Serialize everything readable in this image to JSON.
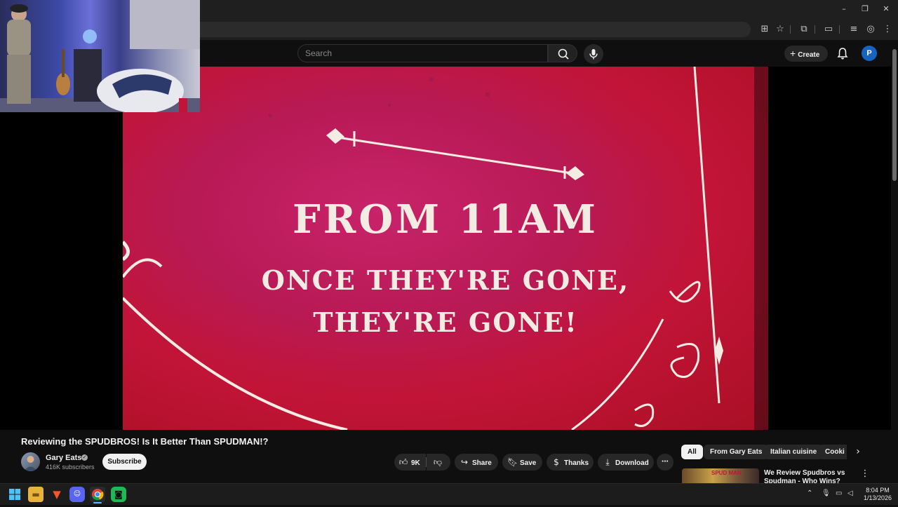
{
  "browser": {
    "window_controls": {
      "minimize": "–",
      "restore": "❐",
      "close": "✕"
    }
  },
  "masthead": {
    "search_placeholder": "Search",
    "create_label": "Create",
    "avatar_letter": "P"
  },
  "video": {
    "sign_line1": "FROM 11AM",
    "sign_line2": "ONCE THEY'RE GONE,",
    "sign_line3": "THEY'RE GONE!"
  },
  "watch": {
    "title": "Reviewing the SPUDBROS! Is It Better Than SPUDMAN!?",
    "channel_name": "Gary Eats",
    "subscribers": "416K subscribers",
    "subscribe_label": "Subscribe",
    "likes": "9K",
    "share_label": "Share",
    "save_label": "Save",
    "thanks_label": "Thanks",
    "download_label": "Download"
  },
  "chips": [
    "All",
    "From Gary Eats",
    "Italian cuisine",
    "Cooki"
  ],
  "recommendation": {
    "title": "We Review Spudbros vs Spudman - Who Wins?",
    "thumb_text": "SPUD MAN"
  },
  "taskbar": {
    "time": "8:04 PM",
    "date": "1/13/2026"
  },
  "colors": {
    "brand_accent": "#1565c0",
    "video_bg": "#c8236a"
  }
}
